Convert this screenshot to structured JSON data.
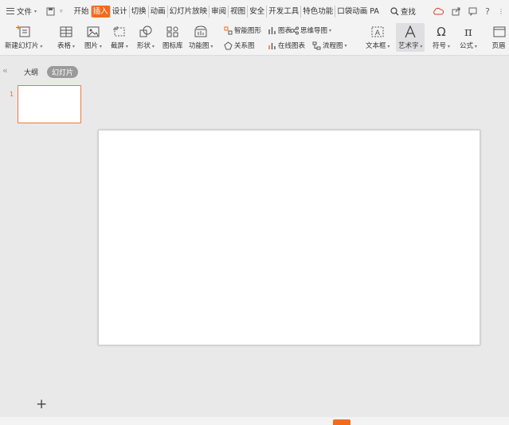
{
  "menubar": {
    "file_label": "文件",
    "tabs": [
      "开始",
      "插入",
      "设计",
      "切换",
      "动画",
      "幻灯片放映",
      "审阅",
      "视图",
      "安全",
      "开发工具",
      "特色功能",
      "口袋动画 PA"
    ],
    "active_tab": "插入",
    "search_label": "查找",
    "help_label": "?"
  },
  "ribbon": {
    "new_slide": "新建幻灯片",
    "table": "表格",
    "picture": "图片",
    "screenshot": "截屏",
    "shape": "形状",
    "icon_library": "图标库",
    "function_chart": "功能图",
    "smart_shape": "智能图形",
    "chart": "图表",
    "mind_map": "思维导图",
    "relation_chart": "关系图",
    "online_chart": "在线图表",
    "flow_chart": "流程图",
    "text_box": "文本框",
    "word_art": "艺术字",
    "symbol": "符号",
    "formula": "公式",
    "header_footer": "页眉"
  },
  "leftpanel": {
    "outline_tab": "大纲",
    "slides_tab": "幻灯片",
    "slide_number": "1",
    "add_label": "+"
  },
  "colors": {
    "accent": "#f26b1d",
    "thumb_border": "#e9793d"
  }
}
